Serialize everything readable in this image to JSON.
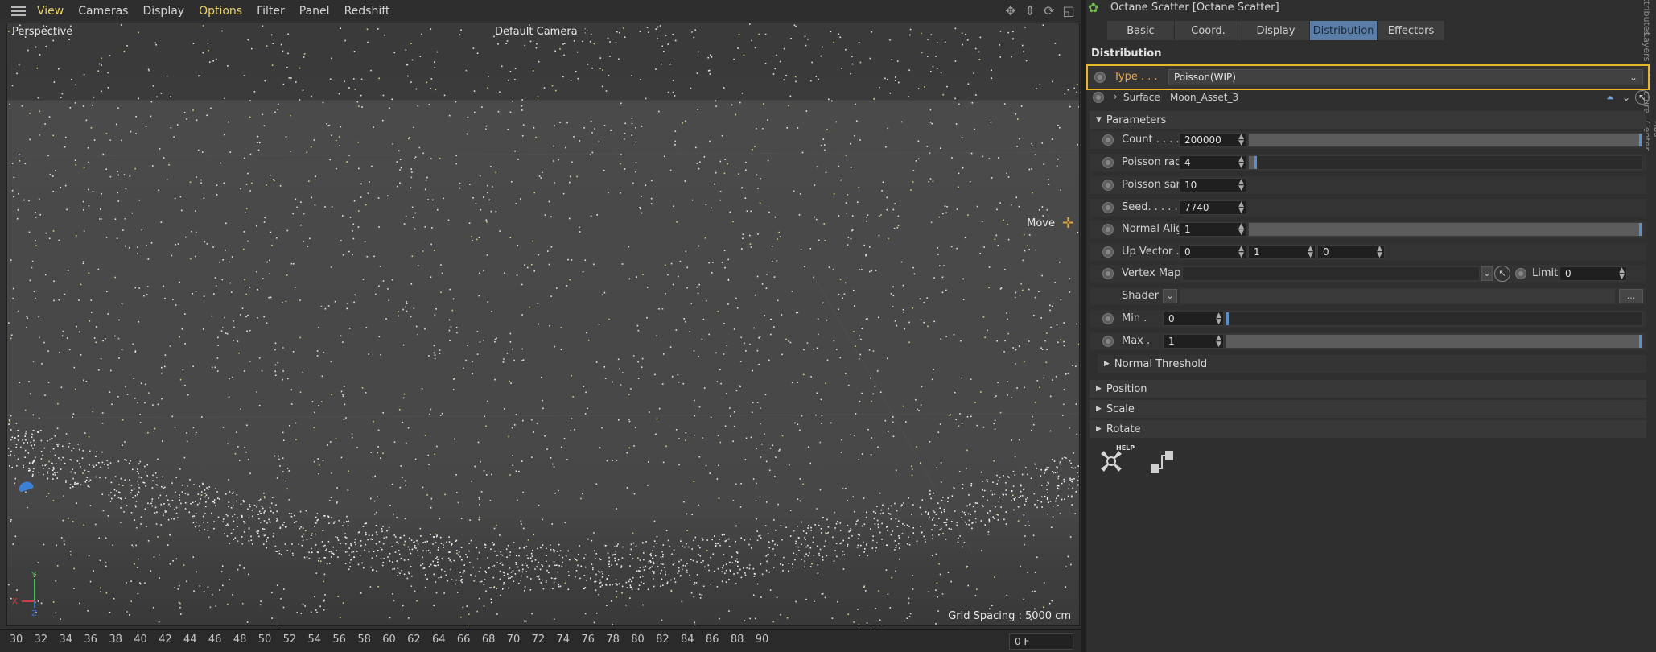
{
  "viewport": {
    "menu": [
      "View",
      "Cameras",
      "Display",
      "Options",
      "Filter",
      "Panel",
      "Redshift"
    ],
    "menu_highlight": [
      "View",
      "Options"
    ],
    "projection": "Perspective",
    "camera": "Default Camera",
    "tool": "Move",
    "grid_spacing": "Grid Spacing : 5000 cm",
    "axes": {
      "x": "X",
      "y": "Y",
      "z": "Z"
    }
  },
  "timeline": {
    "ticks": [
      "30",
      "32",
      "34",
      "36",
      "38",
      "40",
      "42",
      "44",
      "46",
      "48",
      "50",
      "52",
      "54",
      "56",
      "58",
      "60",
      "62",
      "64",
      "66",
      "68",
      "70",
      "72",
      "74",
      "76",
      "78",
      "80",
      "82",
      "84",
      "86",
      "88",
      "90"
    ],
    "current_frame": "0 F"
  },
  "attributes": {
    "object_title": "Octane Scatter [Octane Scatter]",
    "side_tabs": [
      "Attributes",
      "Layers",
      "Structure",
      "Xbs Center"
    ],
    "tabs": [
      {
        "label": "Basic",
        "active": false
      },
      {
        "label": "Coord.",
        "active": false
      },
      {
        "label": "Display",
        "active": false
      },
      {
        "label": "Distribution",
        "active": true
      },
      {
        "label": "Effectors",
        "active": false
      }
    ],
    "section_title": "Distribution",
    "type": {
      "label": "Type . . .",
      "value": "Poisson(WIP)"
    },
    "surface": {
      "label": "Surface",
      "value": "Moon_Asset_3"
    },
    "parameters_header": "Parameters",
    "params": {
      "count": {
        "label": "Count . . . . .",
        "value": "200000",
        "slider": 1.0
      },
      "poisson_radius": {
        "label": "Poisson radius",
        "value": "4",
        "slider": 0.02
      },
      "poisson_samples": {
        "label": "Poisson samples",
        "value": "10"
      },
      "seed": {
        "label": "Seed. . . . . .",
        "value": "7740"
      },
      "normal_align": {
        "label": "Normal Align .",
        "value": "1",
        "slider": 1.0
      },
      "up_vector": {
        "label": "Up Vector . . .",
        "x": "0",
        "y": "1",
        "z": "0"
      },
      "vertex_map": {
        "label": "Vertex Map",
        "value": "",
        "limit_label": "Limit",
        "limit_value": "0"
      },
      "shader": {
        "label": "Shader",
        "more": "..."
      },
      "min": {
        "label": "Min .",
        "value": "0",
        "slider": 0.0
      },
      "max": {
        "label": "Max .",
        "value": "1",
        "slider": 1.0
      }
    },
    "normal_threshold": "Normal Threshold",
    "groups": [
      "Position",
      "Scale",
      "Rotate"
    ],
    "help_label": "HELP"
  },
  "colors": {
    "highlight_border": "#e6b827",
    "active_tab": "#5b7ea8",
    "type_label": "#e7a64b",
    "menu_highlight": "#e8d16a"
  }
}
